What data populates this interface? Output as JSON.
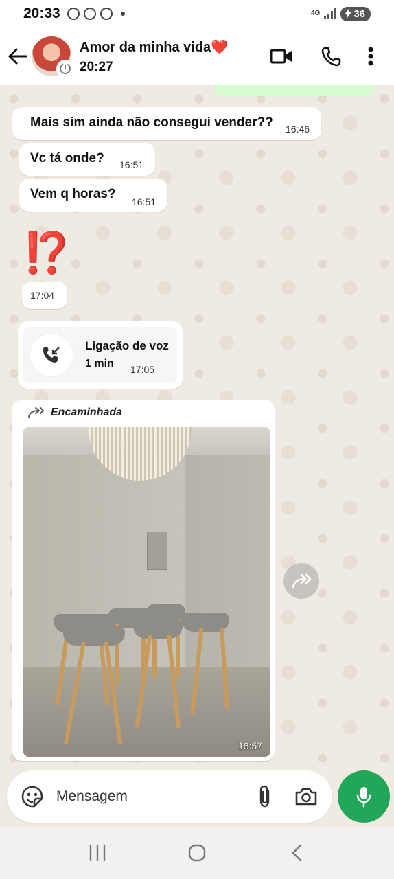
{
  "status_bar": {
    "time": "20:33",
    "network": "4G",
    "battery": "36",
    "icons": [
      "whatsapp-icon",
      "chrome-icon",
      "chrome-icon",
      "dot-icon"
    ]
  },
  "header": {
    "contact_name": "Amor da minha vida❤️",
    "status": "20:27",
    "icons": [
      "back-arrow-icon",
      "video-call-icon",
      "phone-icon",
      "more-vert-icon"
    ]
  },
  "messages": [
    {
      "text": "Mais sim ainda não consegui vender??",
      "time": "16:46"
    },
    {
      "text": "Vc tá onde?",
      "time": "16:51"
    },
    {
      "text": "Vem q horas?",
      "time": "16:51"
    },
    {
      "text": "⁉️",
      "time": "17:04"
    }
  ],
  "voice_call": {
    "label": "Ligação de voz",
    "duration": "1 min",
    "time": "17:05"
  },
  "forwarded_image": {
    "label": "Encaminhada",
    "time": "18:57"
  },
  "composer": {
    "placeholder": "Mensagem"
  },
  "colors": {
    "accent_green": "#21a65a",
    "bubble_in": "#ffffff",
    "bubble_out": "#d9fdd3",
    "chat_bg": "#efeae2"
  }
}
